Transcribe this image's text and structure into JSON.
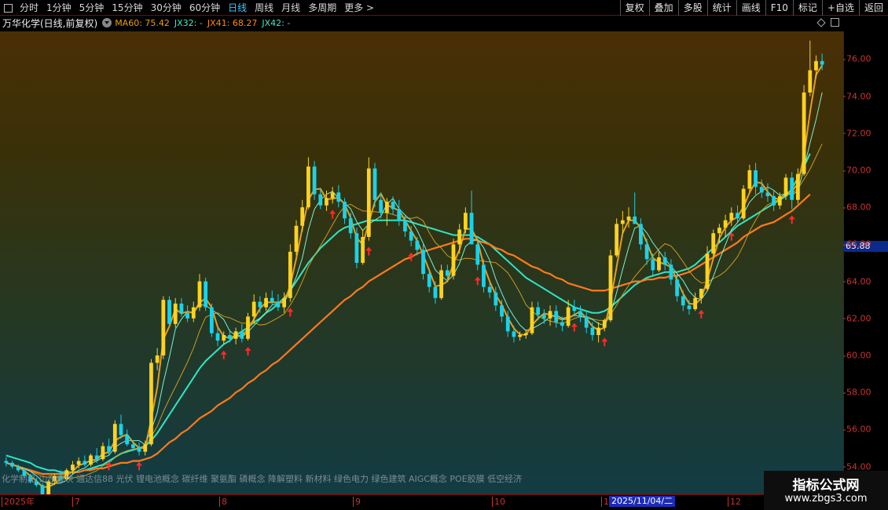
{
  "toolbar": {
    "periods": [
      "分时",
      "1分钟",
      "5分钟",
      "15分钟",
      "30分钟",
      "60分钟",
      "日线",
      "周线",
      "月线",
      "多周期",
      "更多 >"
    ],
    "active_period": "日线",
    "right_buttons": [
      "复权",
      "叠加",
      "多股",
      "统计",
      "画线",
      "F10",
      "标记",
      "+自选",
      "返回"
    ]
  },
  "info": {
    "stock_name": "万华化学(日线,前复权)",
    "indicators": [
      {
        "text": "MA60: 75.42",
        "color": "#e8a000"
      },
      {
        "text": "JX32: -",
        "color": "#3de8c0"
      },
      {
        "text": "JX41: 68.27",
        "color": "#ff8a00"
      },
      {
        "text": "JX42: -",
        "color": "#3de8c0"
      }
    ]
  },
  "concepts": "化学制品 山东板块 通达信88 光伏 锂电池概念 碳纤维 聚氨酯 磷概念 降解塑料 新材料 绿色电力 绿色建筑 AIGC概念 POE胶膜 低空经济",
  "price_axis": {
    "current_price": "65.88",
    "ticks": [
      "76.00",
      "74.00",
      "72.00",
      "70.00",
      "68.00",
      "66.00",
      "64.00",
      "62.00",
      "60.00",
      "58.00",
      "56.00",
      "54.00"
    ]
  },
  "time_axis": {
    "labels": [
      "2025年",
      "7",
      "8",
      "9",
      "10",
      "1",
      "12"
    ],
    "cursor_date": "2025/11/04/二"
  },
  "watermark": {
    "title": "指标公式网",
    "url": "www.zbgs3.com"
  },
  "colors": {
    "up": "#ffd21f",
    "down": "#19d2ea",
    "signal_arrow": "#ff2a2a",
    "ma_orange": "#ff7a1a",
    "ma_gold": "#e0a020",
    "ma_teal": "#2ee6c4",
    "axis_red": "#cc3333"
  },
  "chart_data": {
    "type": "candlestick",
    "ylim": [
      52.5,
      77.5
    ],
    "x_labels": [
      "2025年",
      "7",
      "8",
      "9",
      "10",
      "1",
      "12"
    ],
    "bars": [
      [
        54.3,
        54.5,
        54.0,
        54.2
      ],
      [
        54.2,
        54.3,
        53.9,
        54.0
      ],
      [
        54.0,
        54.1,
        53.7,
        53.8
      ],
      [
        53.8,
        53.9,
        53.4,
        53.5
      ],
      [
        53.5,
        53.6,
        53.1,
        53.2
      ],
      [
        53.2,
        53.4,
        52.9,
        53.0
      ],
      [
        53.0,
        53.1,
        52.3,
        52.5
      ],
      [
        52.5,
        53.3,
        52.2,
        53.2
      ],
      [
        53.2,
        53.6,
        53.0,
        53.5
      ],
      [
        53.5,
        53.8,
        53.2,
        53.3
      ],
      [
        53.3,
        53.9,
        53.2,
        53.8
      ],
      [
        53.8,
        54.3,
        53.6,
        54.1
      ],
      [
        54.1,
        54.5,
        53.9,
        54.3
      ],
      [
        54.3,
        54.6,
        54.0,
        54.1
      ],
      [
        54.1,
        54.7,
        54.0,
        54.6
      ],
      [
        54.6,
        55.0,
        54.2,
        54.4
      ],
      [
        54.4,
        55.3,
        54.3,
        55.1
      ],
      [
        55.1,
        55.5,
        54.6,
        54.8
      ],
      [
        54.8,
        56.5,
        54.7,
        56.3
      ],
      [
        56.3,
        56.8,
        55.5,
        55.7
      ],
      [
        55.7,
        56.0,
        55.1,
        55.2
      ],
      [
        55.2,
        55.4,
        54.9,
        55.0
      ],
      [
        55.0,
        55.3,
        54.6,
        54.8
      ],
      [
        54.8,
        55.4,
        54.6,
        55.2
      ],
      [
        55.2,
        59.8,
        55.1,
        59.6
      ],
      [
        59.6,
        60.4,
        59.2,
        60.0
      ],
      [
        60.0,
        63.2,
        59.8,
        63.0
      ],
      [
        63.0,
        63.2,
        61.5,
        61.7
      ],
      [
        61.7,
        63.1,
        61.5,
        62.8
      ],
      [
        62.8,
        63.1,
        62.1,
        62.3
      ],
      [
        62.3,
        62.7,
        61.8,
        62.0
      ],
      [
        62.0,
        62.9,
        61.8,
        62.6
      ],
      [
        62.6,
        64.4,
        62.4,
        64.0
      ],
      [
        64.0,
        64.2,
        62.4,
        62.6
      ],
      [
        62.6,
        62.8,
        61.0,
        61.2
      ],
      [
        61.2,
        61.5,
        60.5,
        60.8
      ],
      [
        60.8,
        61.3,
        60.6,
        61.1
      ],
      [
        61.1,
        61.4,
        60.7,
        60.9
      ],
      [
        60.9,
        61.5,
        60.6,
        61.3
      ],
      [
        61.3,
        61.7,
        60.7,
        60.9
      ],
      [
        60.9,
        62.3,
        60.8,
        62.1
      ],
      [
        62.1,
        63.3,
        61.7,
        62.9
      ],
      [
        62.9,
        63.2,
        62.3,
        62.6
      ],
      [
        62.6,
        63.4,
        62.4,
        63.1
      ],
      [
        63.1,
        63.5,
        62.7,
        62.9
      ],
      [
        62.9,
        63.3,
        62.4,
        62.6
      ],
      [
        62.6,
        63.4,
        62.3,
        63.1
      ],
      [
        63.1,
        66.0,
        62.9,
        65.6
      ],
      [
        65.6,
        67.3,
        65.4,
        67.0
      ],
      [
        67.0,
        68.4,
        66.7,
        68.0
      ],
      [
        68.0,
        70.7,
        67.9,
        70.2
      ],
      [
        70.2,
        70.5,
        68.4,
        68.7
      ],
      [
        68.7,
        69.0,
        67.9,
        68.1
      ],
      [
        68.1,
        68.9,
        67.8,
        68.5
      ],
      [
        68.5,
        69.1,
        68.2,
        68.8
      ],
      [
        68.8,
        69.2,
        68.0,
        68.3
      ],
      [
        68.3,
        68.5,
        67.1,
        67.4
      ],
      [
        67.4,
        67.7,
        66.3,
        66.6
      ],
      [
        66.6,
        66.9,
        64.7,
        65.0
      ],
      [
        65.0,
        66.8,
        64.9,
        66.4
      ],
      [
        66.4,
        70.7,
        66.2,
        70.1
      ],
      [
        70.1,
        70.4,
        68.0,
        68.4
      ],
      [
        68.4,
        68.8,
        67.4,
        67.7
      ],
      [
        67.7,
        68.5,
        67.0,
        68.3
      ],
      [
        68.3,
        68.6,
        67.6,
        67.9
      ],
      [
        67.9,
        68.4,
        67.0,
        67.3
      ],
      [
        67.3,
        67.6,
        66.4,
        66.7
      ],
      [
        66.7,
        67.0,
        65.9,
        66.2
      ],
      [
        66.2,
        66.4,
        65.4,
        65.7
      ],
      [
        65.7,
        66.0,
        64.1,
        64.4
      ],
      [
        64.4,
        64.7,
        63.4,
        63.7
      ],
      [
        63.7,
        64.0,
        62.8,
        63.1
      ],
      [
        63.1,
        64.9,
        63.0,
        64.6
      ],
      [
        64.6,
        64.9,
        64.0,
        64.3
      ],
      [
        64.3,
        66.3,
        64.1,
        66.0
      ],
      [
        66.0,
        67.1,
        65.5,
        66.8
      ],
      [
        66.8,
        68.0,
        66.6,
        67.7
      ],
      [
        67.7,
        68.9,
        67.4,
        66.0
      ],
      [
        66.0,
        66.3,
        64.6,
        64.9
      ],
      [
        64.9,
        65.2,
        63.4,
        63.7
      ],
      [
        63.7,
        64.0,
        63.1,
        63.4
      ],
      [
        63.4,
        63.7,
        62.4,
        62.7
      ],
      [
        62.7,
        63.0,
        61.8,
        62.1
      ],
      [
        62.1,
        62.4,
        61.0,
        61.3
      ],
      [
        61.3,
        61.6,
        60.7,
        61.0
      ],
      [
        61.0,
        61.3,
        60.8,
        61.1
      ],
      [
        61.1,
        61.4,
        60.9,
        61.2
      ],
      [
        61.2,
        62.9,
        61.1,
        62.6
      ],
      [
        62.6,
        62.9,
        61.9,
        62.2
      ],
      [
        62.2,
        62.5,
        61.7,
        62.0
      ],
      [
        62.0,
        62.7,
        61.6,
        62.4
      ],
      [
        62.4,
        62.7,
        61.5,
        61.8
      ],
      [
        61.8,
        62.1,
        61.3,
        61.6
      ],
      [
        61.6,
        63.0,
        61.5,
        62.6
      ],
      [
        62.6,
        63.0,
        62.1,
        62.4
      ],
      [
        62.4,
        62.7,
        61.8,
        62.1
      ],
      [
        62.1,
        62.4,
        61.2,
        61.5
      ],
      [
        61.5,
        61.8,
        60.8,
        61.1
      ],
      [
        61.1,
        61.8,
        60.7,
        61.5
      ],
      [
        61.5,
        62.0,
        61.3,
        61.9
      ],
      [
        61.9,
        65.7,
        61.8,
        65.4
      ],
      [
        65.4,
        67.4,
        65.3,
        67.1
      ],
      [
        67.1,
        67.8,
        66.6,
        67.3
      ],
      [
        67.3,
        68.0,
        66.9,
        67.5
      ],
      [
        67.5,
        68.8,
        67.2,
        67.1
      ],
      [
        67.1,
        67.4,
        65.7,
        66.0
      ],
      [
        66.0,
        66.3,
        64.9,
        65.2
      ],
      [
        65.2,
        65.5,
        64.3,
        64.6
      ],
      [
        64.6,
        65.6,
        64.5,
        65.3
      ],
      [
        65.3,
        65.6,
        64.6,
        64.9
      ],
      [
        64.9,
        65.2,
        63.8,
        64.1
      ],
      [
        64.1,
        64.4,
        62.9,
        63.2
      ],
      [
        63.2,
        63.5,
        62.4,
        62.7
      ],
      [
        62.7,
        63.0,
        62.2,
        62.5
      ],
      [
        62.5,
        63.4,
        62.4,
        63.1
      ],
      [
        63.1,
        63.4,
        62.8,
        63.6
      ],
      [
        63.6,
        65.9,
        63.5,
        65.5
      ],
      [
        65.5,
        66.8,
        65.3,
        66.6
      ],
      [
        66.6,
        67.1,
        66.1,
        66.9
      ],
      [
        66.9,
        67.6,
        66.4,
        67.3
      ],
      [
        67.3,
        68.0,
        67.0,
        67.7
      ],
      [
        67.7,
        68.1,
        67.2,
        67.4
      ],
      [
        67.4,
        69.2,
        67.3,
        69.0
      ],
      [
        69.0,
        70.3,
        68.8,
        70.0
      ],
      [
        70.0,
        70.4,
        68.7,
        69.1
      ],
      [
        69.1,
        69.5,
        68.5,
        68.8
      ],
      [
        68.8,
        69.3,
        68.3,
        68.6
      ],
      [
        68.6,
        68.9,
        67.8,
        68.1
      ],
      [
        68.1,
        68.8,
        67.9,
        68.6
      ],
      [
        68.6,
        69.8,
        68.4,
        69.6
      ],
      [
        69.6,
        69.9,
        67.9,
        68.4
      ],
      [
        68.4,
        70.1,
        68.2,
        69.8
      ],
      [
        69.8,
        74.6,
        69.7,
        74.2
      ],
      [
        74.2,
        77.0,
        74.0,
        75.4
      ],
      [
        75.4,
        76.2,
        75.0,
        75.9
      ],
      [
        75.9,
        76.3,
        75.4,
        75.7
      ]
    ],
    "signal_bar_indices": [
      6,
      17,
      22,
      36,
      40,
      47,
      54,
      60,
      67,
      78,
      94,
      99,
      115,
      120,
      130
    ],
    "ma_lines": {
      "ma_orange": [
        54.2,
        54.1,
        54.0,
        53.9,
        53.8,
        53.7,
        53.6,
        53.6,
        53.6,
        53.6,
        53.6,
        53.7,
        53.7,
        53.8,
        53.8,
        53.9,
        53.9,
        54.0,
        54.1,
        54.2,
        54.2,
        54.3,
        54.3,
        54.4,
        54.5,
        54.7,
        55.0,
        55.3,
        55.5,
        55.8,
        56.0,
        56.3,
        56.6,
        56.8,
        57.0,
        57.3,
        57.5,
        57.7,
        58.0,
        58.2,
        58.5,
        58.7,
        59.0,
        59.2,
        59.5,
        59.7,
        60.0,
        60.3,
        60.6,
        60.9,
        61.2,
        61.5,
        61.8,
        62.1,
        62.4,
        62.7,
        63.0,
        63.2,
        63.5,
        63.7,
        64.0,
        64.2,
        64.4,
        64.6,
        64.8,
        65.0,
        65.2,
        65.3,
        65.5,
        65.6,
        65.7,
        65.8,
        65.9,
        66.0,
        66.1,
        66.2,
        66.3,
        66.3,
        66.2,
        66.1,
        66.0,
        65.8,
        65.7,
        65.5,
        65.4,
        65.2,
        65.0,
        64.8,
        64.7,
        64.5,
        64.4,
        64.2,
        64.1,
        63.9,
        63.8,
        63.7,
        63.6,
        63.5,
        63.5,
        63.5,
        63.6,
        63.7,
        63.8,
        63.9,
        64.0,
        64.0,
        64.1,
        64.1,
        64.2,
        64.2,
        64.3,
        64.3,
        64.4,
        64.5,
        64.7,
        64.9,
        65.1,
        65.3,
        65.5,
        65.7,
        65.9,
        66.1,
        66.4,
        66.6,
        66.8,
        67.0,
        67.1,
        67.2,
        67.4,
        67.6,
        67.8,
        68.1,
        68.4,
        68.7
      ],
      "ma_teal": [
        54.6,
        54.5,
        54.4,
        54.3,
        54.2,
        54.0,
        53.9,
        53.8,
        53.8,
        53.7,
        53.7,
        53.7,
        53.7,
        53.8,
        53.9,
        54.0,
        54.1,
        54.3,
        54.5,
        54.7,
        54.8,
        54.9,
        55.0,
        55.1,
        55.4,
        55.8,
        56.3,
        56.8,
        57.3,
        57.8,
        58.3,
        58.8,
        59.3,
        59.7,
        60.0,
        60.3,
        60.6,
        60.8,
        61.1,
        61.3,
        61.5,
        61.8,
        62.0,
        62.3,
        62.5,
        62.8,
        63.1,
        63.5,
        64.0,
        64.5,
        65.0,
        65.4,
        65.8,
        66.1,
        66.4,
        66.7,
        66.9,
        67.0,
        67.1,
        67.2,
        67.3,
        67.3,
        67.3,
        67.3,
        67.3,
        67.3,
        67.3,
        67.2,
        67.1,
        67.0,
        66.9,
        66.8,
        66.7,
        66.6,
        66.5,
        66.5,
        66.5,
        66.5,
        66.4,
        66.2,
        66.0,
        65.7,
        65.4,
        65.1,
        64.8,
        64.5,
        64.2,
        64.0,
        63.8,
        63.6,
        63.4,
        63.2,
        63.0,
        62.8,
        62.6,
        62.5,
        62.4,
        62.3,
        62.3,
        62.4,
        62.6,
        62.9,
        63.2,
        63.5,
        63.8,
        64.0,
        64.2,
        64.3,
        64.4,
        64.5,
        64.5,
        64.5,
        64.6,
        64.7,
        64.9,
        65.2,
        65.5,
        65.8,
        66.1,
        66.4,
        66.7,
        67.0,
        67.2,
        67.4,
        67.6,
        67.8,
        68.0,
        68.2,
        68.4,
        68.6,
        69.0,
        69.6,
        70.2,
        70.9
      ]
    }
  }
}
